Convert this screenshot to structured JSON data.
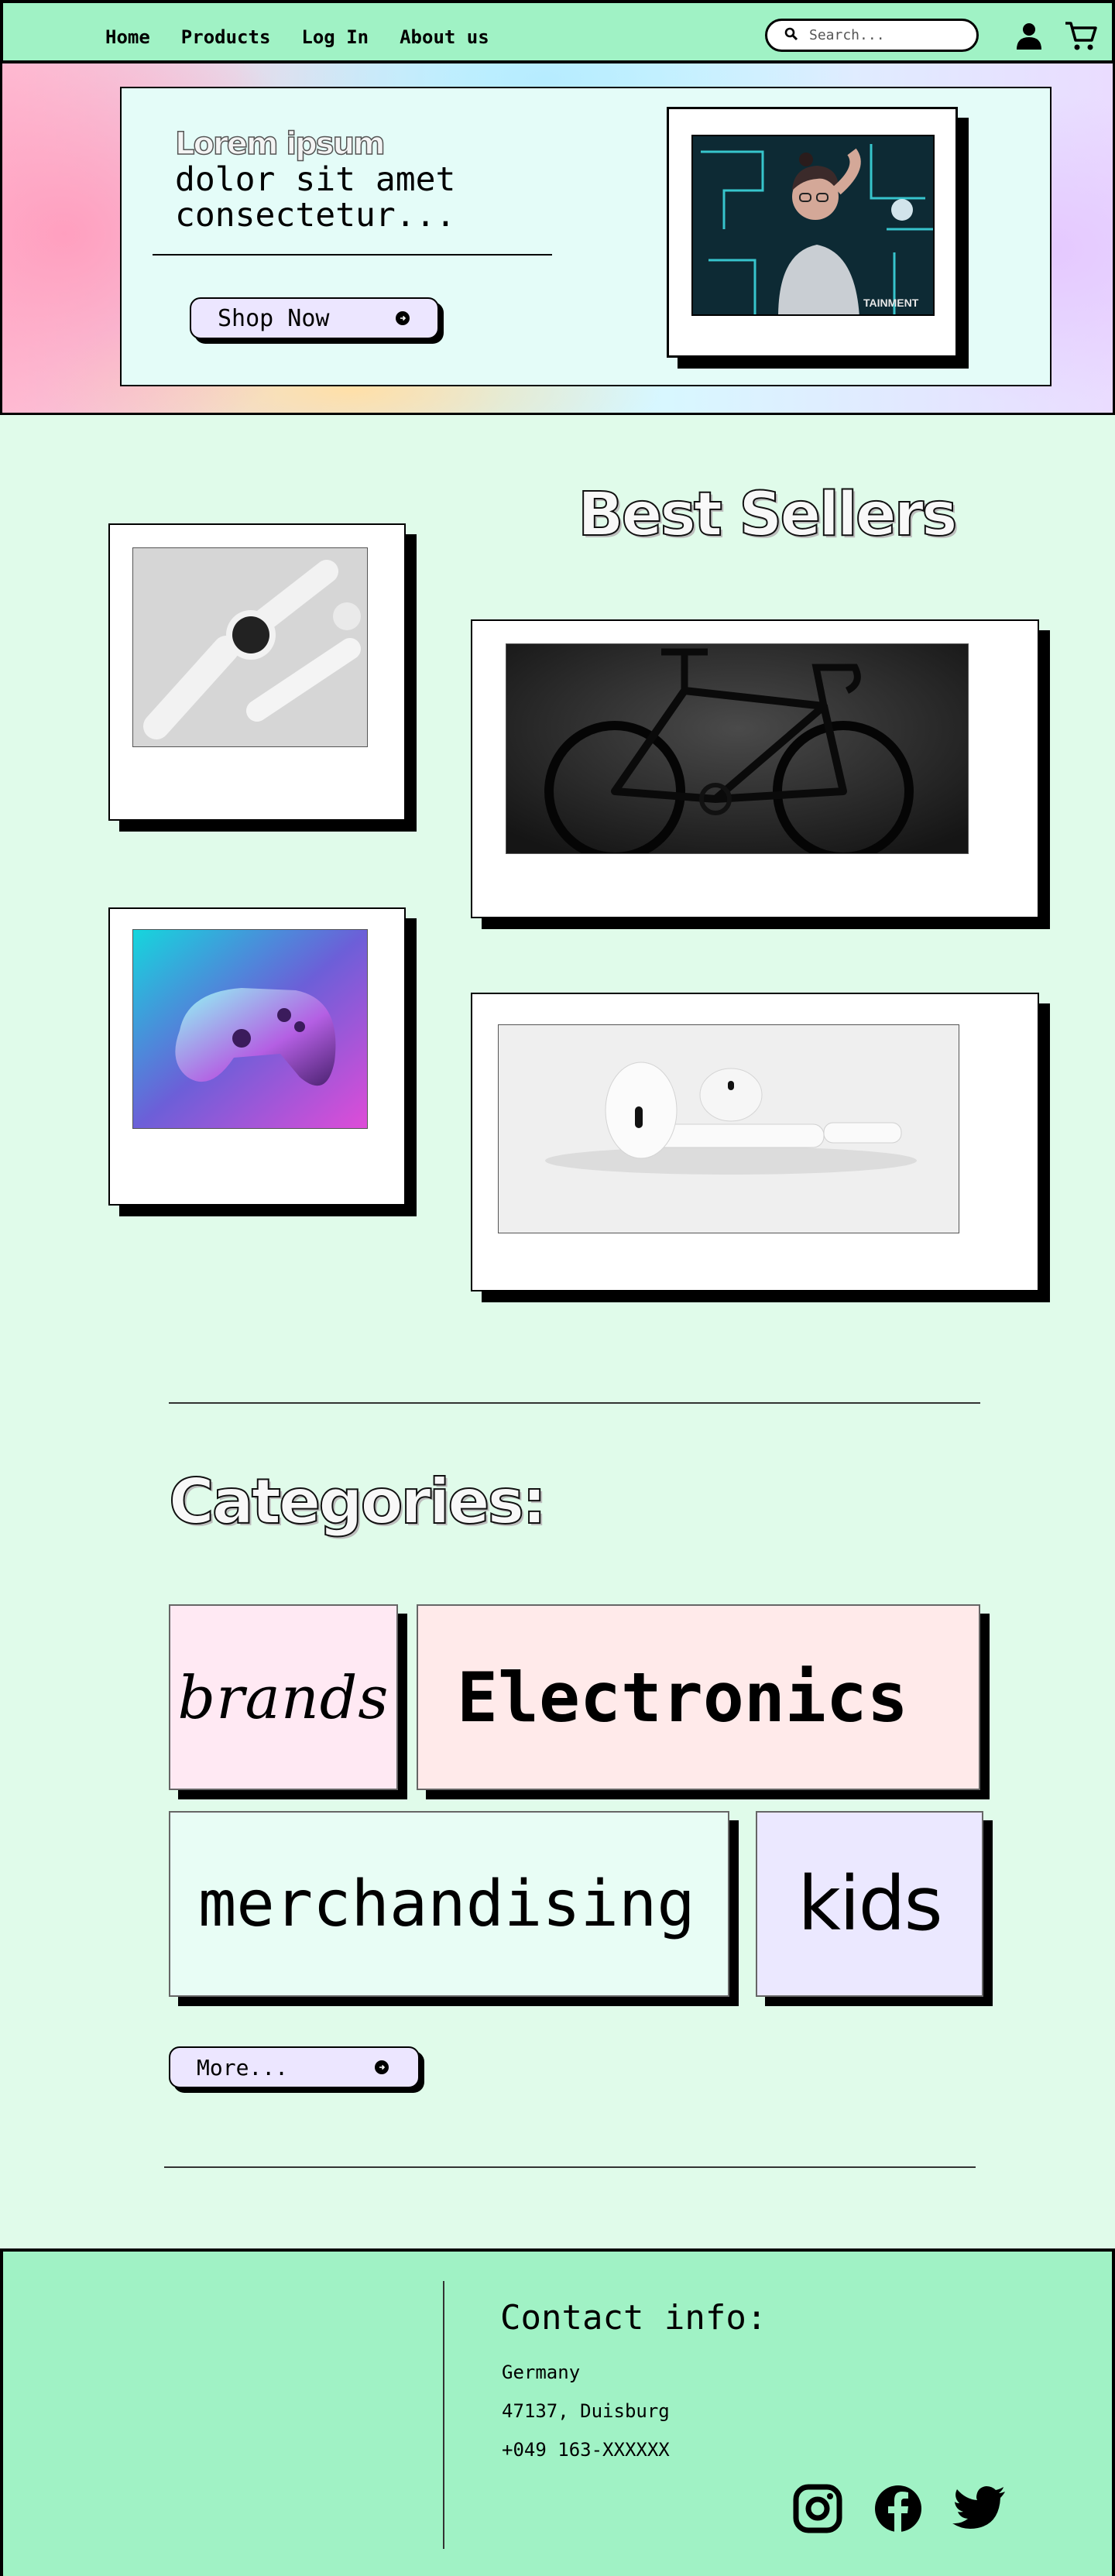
{
  "nav": {
    "links": [
      "Home",
      "Products",
      "Log In",
      "About us"
    ],
    "search_placeholder": "Search...",
    "icons": [
      "search-icon",
      "user-icon",
      "cart-icon"
    ]
  },
  "hero": {
    "headline_outlined": "Lorem ipsum",
    "headline_rest": " dolor sit amet consectetur...",
    "button_label": "Shop Now"
  },
  "best_sellers": {
    "title": "Best Sellers",
    "products": [
      "smartwatch",
      "road-bike",
      "game-controller",
      "wireless-earbuds"
    ]
  },
  "categories": {
    "title": "Categories:",
    "items": [
      "brands",
      "Electronics",
      "merchandising",
      "kids"
    ],
    "more_label": "More..."
  },
  "footer": {
    "contact_title": "Contact info:",
    "country": "Germany",
    "city": "47137, Duisburg",
    "phone": "+049 163-XXXXXX",
    "social": [
      "instagram-icon",
      "facebook-icon",
      "twitter-icon"
    ]
  },
  "colors": {
    "nav_bg": "#a0f2c5",
    "page_bg": "#e0fbea",
    "button_bg": "#ece6ff",
    "cat_brands": "#ffe9f3",
    "cat_electronics": "#ffeaea",
    "cat_merch": "#e8fdf5",
    "cat_kids": "#ebe8ff"
  }
}
